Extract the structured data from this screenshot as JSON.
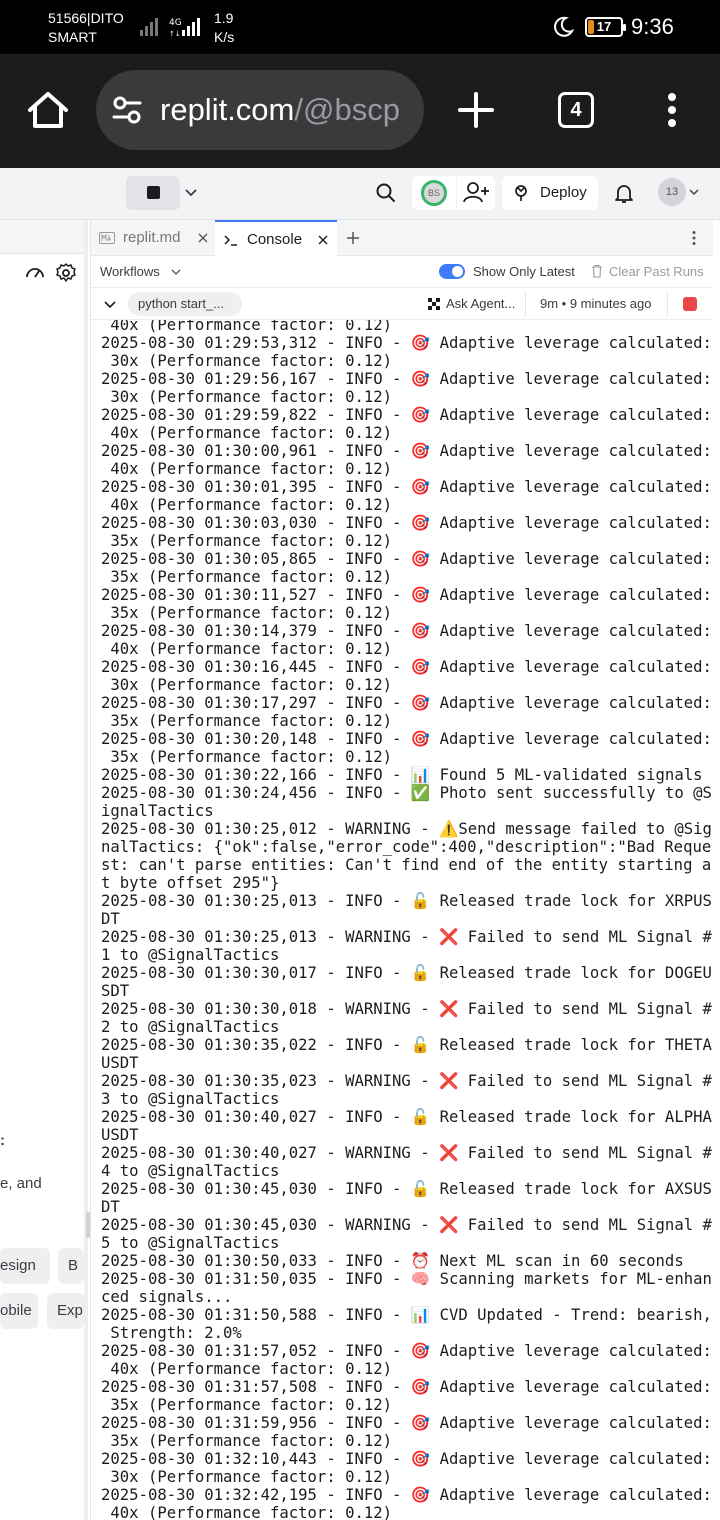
{
  "status_bar": {
    "carrier_line1": "51566|DITO",
    "carrier_line2": "SMART",
    "network_type": "4G",
    "speed_value": "1.9",
    "speed_unit": "K/s",
    "battery_level": "17",
    "battery_percent": 17,
    "time": "9:36"
  },
  "browser": {
    "url_domain": "replit.com",
    "url_path": "/@bscp",
    "tab_count": "4"
  },
  "replit_header": {
    "avatar_initials": "BS",
    "deploy_label": "Deploy",
    "notification_count": "13"
  },
  "left_panel": {
    "text_fragment": "e, and",
    "chip_design": "esign",
    "chip_b": "B",
    "chip_mobile": "obile",
    "chip_exp": "Exp"
  },
  "tabs": [
    {
      "label": "replit.md",
      "icon": "markdown-icon"
    },
    {
      "label": "Console",
      "icon": "terminal-icon"
    }
  ],
  "workflow_bar": {
    "workflows_label": "Workflows",
    "show_only_latest": "Show Only Latest",
    "show_only_latest_enabled": true,
    "clear_label": "Clear Past Runs"
  },
  "run_bar": {
    "command": "python start_...",
    "ask_agent": "Ask Agent...",
    "run_time": "9m • 9 minutes ago"
  },
  "console_lines": [
    " 40x (Performance factor: 0.12)",
    "2025-08-30 01:29:53,312 - INFO - 🎯 Adaptive leverage calculated:",
    " 30x (Performance factor: 0.12)",
    "2025-08-30 01:29:56,167 - INFO - 🎯 Adaptive leverage calculated:",
    " 30x (Performance factor: 0.12)",
    "2025-08-30 01:29:59,822 - INFO - 🎯 Adaptive leverage calculated:",
    " 40x (Performance factor: 0.12)",
    "2025-08-30 01:30:00,961 - INFO - 🎯 Adaptive leverage calculated:",
    " 40x (Performance factor: 0.12)",
    "2025-08-30 01:30:01,395 - INFO - 🎯 Adaptive leverage calculated:",
    " 40x (Performance factor: 0.12)",
    "2025-08-30 01:30:03,030 - INFO - 🎯 Adaptive leverage calculated:",
    " 35x (Performance factor: 0.12)",
    "2025-08-30 01:30:05,865 - INFO - 🎯 Adaptive leverage calculated:",
    " 35x (Performance factor: 0.12)",
    "2025-08-30 01:30:11,527 - INFO - 🎯 Adaptive leverage calculated:",
    " 35x (Performance factor: 0.12)",
    "2025-08-30 01:30:14,379 - INFO - 🎯 Adaptive leverage calculated:",
    " 40x (Performance factor: 0.12)",
    "2025-08-30 01:30:16,445 - INFO - 🎯 Adaptive leverage calculated:",
    " 30x (Performance factor: 0.12)",
    "2025-08-30 01:30:17,297 - INFO - 🎯 Adaptive leverage calculated:",
    " 35x (Performance factor: 0.12)",
    "2025-08-30 01:30:20,148 - INFO - 🎯 Adaptive leverage calculated:",
    " 35x (Performance factor: 0.12)",
    "2025-08-30 01:30:22,166 - INFO - 📊 Found 5 ML-validated signals",
    "2025-08-30 01:30:24,456 - INFO - ✅ Photo sent successfully to @S",
    "ignalTactics",
    "2025-08-30 01:30:25,012 - WARNING - ⚠️Send message failed to @Sig",
    "nalTactics: {\"ok\":false,\"error_code\":400,\"description\":\"Bad Reque",
    "st: can't parse entities: Can't find end of the entity starting a",
    "t byte offset 295\"}",
    "2025-08-30 01:30:25,013 - INFO - 🔓 Released trade lock for XRPUS",
    "DT",
    "2025-08-30 01:30:25,013 - WARNING - ❌ Failed to send ML Signal #",
    "1 to @SignalTactics",
    "2025-08-30 01:30:30,017 - INFO - 🔓 Released trade lock for DOGEU",
    "SDT",
    "2025-08-30 01:30:30,018 - WARNING - ❌ Failed to send ML Signal #",
    "2 to @SignalTactics",
    "2025-08-30 01:30:35,022 - INFO - 🔓 Released trade lock for THETA",
    "USDT",
    "2025-08-30 01:30:35,023 - WARNING - ❌ Failed to send ML Signal #",
    "3 to @SignalTactics",
    "2025-08-30 01:30:40,027 - INFO - 🔓 Released trade lock for ALPHA",
    "USDT",
    "2025-08-30 01:30:40,027 - WARNING - ❌ Failed to send ML Signal #",
    "4 to @SignalTactics",
    "2025-08-30 01:30:45,030 - INFO - 🔓 Released trade lock for AXSUS",
    "DT",
    "2025-08-30 01:30:45,030 - WARNING - ❌ Failed to send ML Signal #",
    "5 to @SignalTactics",
    "2025-08-30 01:30:50,033 - INFO - ⏰ Next ML scan in 60 seconds",
    "2025-08-30 01:31:50,035 - INFO - 🧠 Scanning markets for ML-enhan",
    "ced signals...",
    "2025-08-30 01:31:50,588 - INFO - 📊 CVD Updated - Trend: bearish,",
    " Strength: 2.0%",
    "2025-08-30 01:31:57,052 - INFO - 🎯 Adaptive leverage calculated:",
    " 40x (Performance factor: 0.12)",
    "2025-08-30 01:31:57,508 - INFO - 🎯 Adaptive leverage calculated:",
    " 35x (Performance factor: 0.12)",
    "2025-08-30 01:31:59,956 - INFO - 🎯 Adaptive leverage calculated:",
    " 35x (Performance factor: 0.12)",
    "2025-08-30 01:32:10,443 - INFO - 🎯 Adaptive leverage calculated:",
    " 30x (Performance factor: 0.12)",
    "2025-08-30 01:32:42,195 - INFO - 🎯 Adaptive leverage calculated:",
    " 40x (Performance factor: 0.12)"
  ],
  "colors": {
    "accent": "#3d7bf7",
    "stop_red": "#e8484a",
    "avatar_ring": "#39b56a",
    "battery_low": "#e88a1a"
  }
}
